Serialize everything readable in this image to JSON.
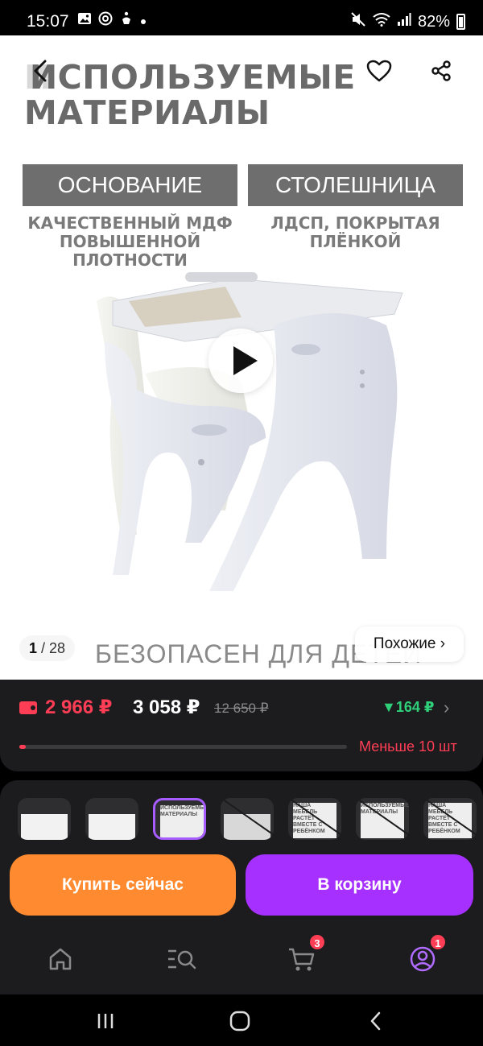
{
  "status_bar": {
    "time": "15:07",
    "left_icons": [
      "image-icon",
      "at-icon",
      "accessibility-icon",
      "dot-icon"
    ],
    "right_icons": [
      "mute-icon",
      "wifi-icon",
      "signal-icon"
    ],
    "battery": "82%"
  },
  "hero": {
    "title_line1": "ИСПОЛЬЗУЕМЫЕ",
    "title_line2": "МАТЕРИАЛЫ",
    "specs": [
      {
        "label": "ОСНОВАНИЕ",
        "desc_line1": "КАЧЕСТВЕННЫЙ МДФ",
        "desc_line2": "ПОВЫШЕННОЙ",
        "desc_line3": "ПЛОТНОСТИ"
      },
      {
        "label": "СТОЛЕШНИЦА",
        "desc_line1": "ЛДСП, ПОКРЫТАЯ",
        "desc_line2": "ПЛЁНКОЙ",
        "desc_line3": ""
      }
    ],
    "caption": "БЕЗОПАСЕН ДЛЯ ДЕТЕЙ",
    "counter_current": "1",
    "counter_total": "28",
    "similar_label": "Похожие ›"
  },
  "price": {
    "wallet_price": "2 966 ₽",
    "price": "3 058 ₽",
    "old_price": "12 650 ₽",
    "saving": "▼164 ₽",
    "stock_label": "Меньше 10 шт",
    "stock_level": 0.02
  },
  "actions": {
    "buy_now": "Купить сейчас",
    "add_to_cart": "В корзину"
  },
  "thumbnails": [
    {
      "kind": "photo"
    },
    {
      "kind": "photo"
    },
    {
      "kind": "text",
      "text": "ИСПОЛЬЗУЕМЫЕ МАТЕРИАЛЫ"
    },
    {
      "kind": "dark"
    },
    {
      "kind": "text",
      "text": "НАША МЕБЕЛЬ РАСТЁТ ВМЕСТЕ С РЕБЁНКОМ"
    },
    {
      "kind": "text",
      "text": "ИСПОЛЬЗУЕМЫЕ МАТЕРИАЛЫ"
    },
    {
      "kind": "text",
      "text": "НАША МЕБЕЛЬ РАСТЁТ ВМЕСТЕ С РЕБЁНКОМ"
    }
  ],
  "bottom_nav": {
    "items": [
      "home-icon",
      "catalog-search-icon",
      "cart-icon",
      "profile-icon"
    ],
    "cart_badge": "3",
    "profile_badge": "1"
  },
  "colors": {
    "accent_purple": "#a530ff",
    "accent_orange": "#ff8a2f",
    "price_red": "#ff3d55",
    "saving_green": "#2fd07a"
  }
}
